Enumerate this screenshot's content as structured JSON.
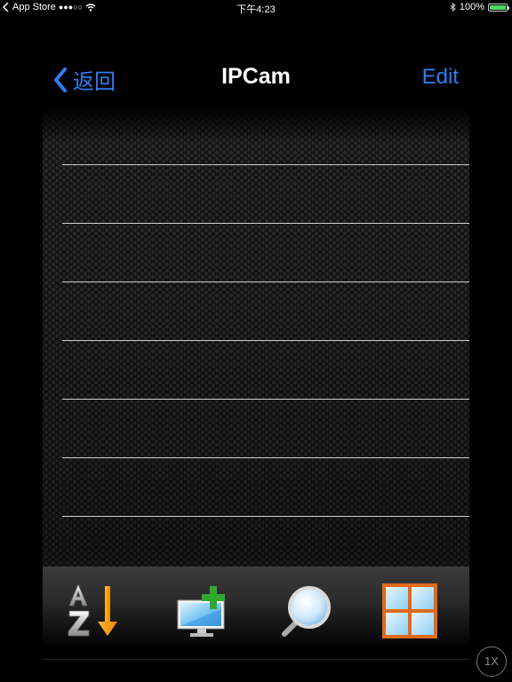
{
  "status_bar": {
    "carrier": "App Store",
    "signal": "●●●○○",
    "time": "下午4:23",
    "battery": "100%"
  },
  "nav": {
    "back_label": "返回",
    "title": "IPCam",
    "edit_label": "Edit"
  },
  "list": {
    "rows": [
      "",
      "",
      "",
      "",
      "",
      "",
      ""
    ]
  },
  "toolbar": {
    "icons": [
      "sort-az-icon",
      "add-camera-icon",
      "search-icon",
      "grid-view-icon"
    ]
  },
  "zoom": {
    "label": "1X"
  },
  "colors": {
    "accent": "#2f7cf6",
    "background": "#000000",
    "battery": "#4cd964"
  }
}
